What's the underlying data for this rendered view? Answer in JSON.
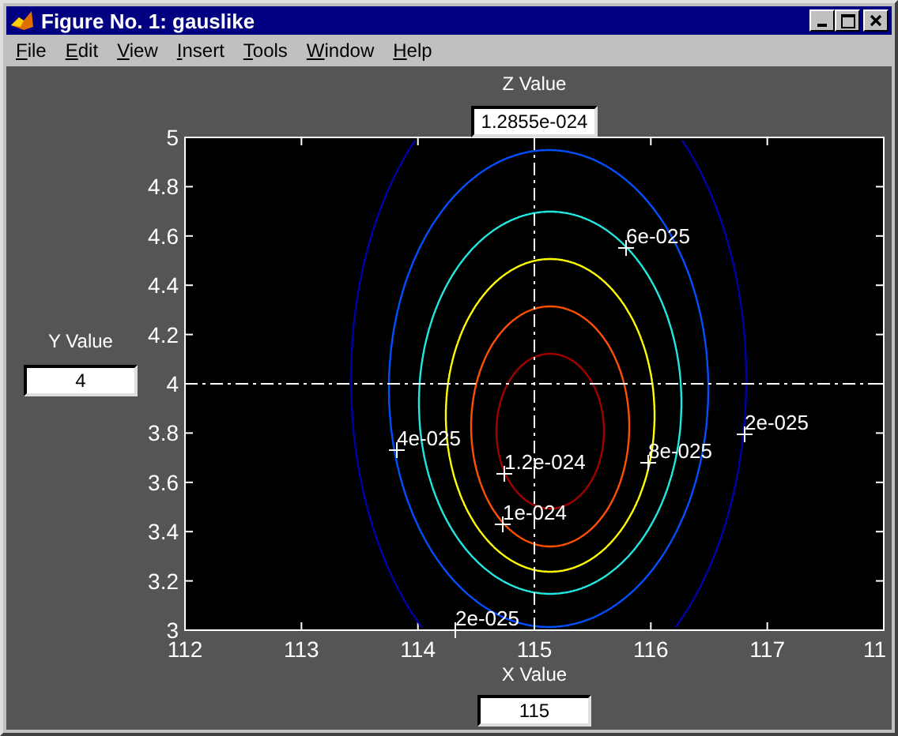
{
  "window": {
    "title": "Figure No. 1: gauslike"
  },
  "menu": [
    "File",
    "Edit",
    "View",
    "Insert",
    "Tools",
    "Window",
    "Help"
  ],
  "z_value": {
    "label": "Z Value",
    "value": "1.2855e-024"
  },
  "y_value": {
    "label": "Y Value",
    "value": "4"
  },
  "x_value": {
    "label": "X Value",
    "value": "115"
  },
  "plot": {
    "xticks": [
      "112",
      "113",
      "114",
      "115",
      "116",
      "117",
      "11"
    ],
    "yticks": [
      "5",
      "4.8",
      "4.6",
      "4.4",
      "4.2",
      "4",
      "3.8",
      "3.6",
      "3.4",
      "3.2",
      "3"
    ],
    "contour_labels": [
      "6e-025",
      "4e-025",
      "2e-025",
      "8e-025",
      "1.2e-024",
      "1e-024",
      "2e-025"
    ]
  }
}
